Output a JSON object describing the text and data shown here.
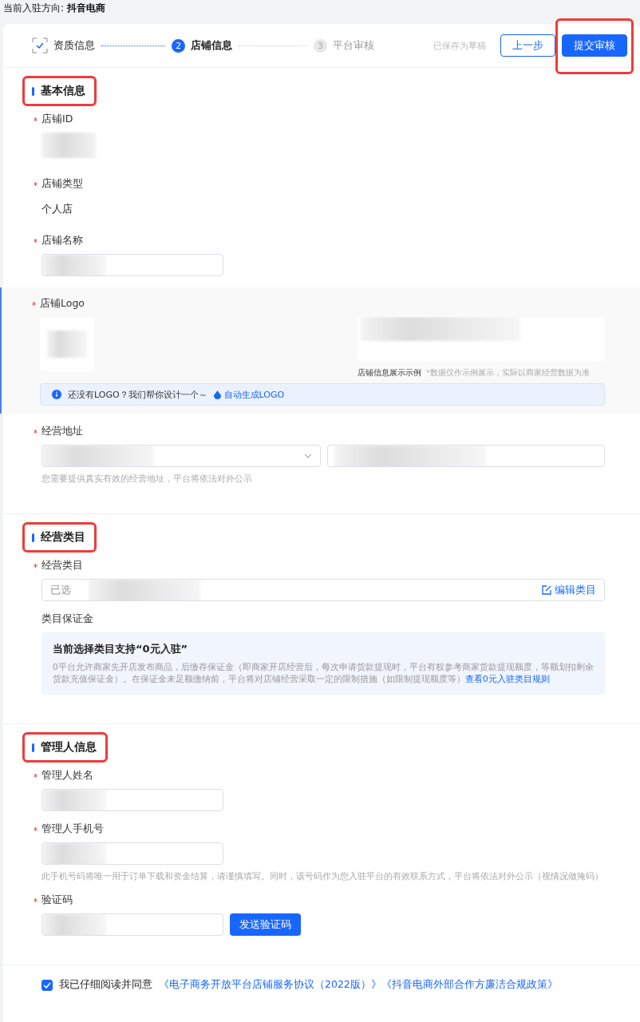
{
  "header": {
    "label": "当前入驻方向:",
    "value": "抖音电商"
  },
  "steps": [
    {
      "label": "资质信息",
      "completed": true,
      "selected": false
    },
    {
      "label": "店铺信息",
      "number": "2",
      "completed": false,
      "selected": true
    },
    {
      "label": "平台审核",
      "number": "3",
      "completed": false,
      "selected": false
    }
  ],
  "draft_status": "已保存为草稿",
  "buttons": [
    {
      "label": "上一步",
      "kind": "outline",
      "highlighted": false
    },
    {
      "label": "提交审核",
      "kind": "primary",
      "highlighted": true
    }
  ],
  "sections": [
    {
      "title": "基本信息",
      "highlighted": true,
      "fields": [
        {
          "kind": "redacted",
          "label": "店铺ID",
          "required": true
        },
        {
          "kind": "text",
          "label": "店铺类型",
          "required": true,
          "value": "个人店"
        },
        {
          "kind": "input",
          "label": "店铺名称",
          "required": true
        },
        {
          "kind": "logo",
          "label": "店铺Logo",
          "required": true,
          "preview_caption": "店铺信息展示示例",
          "preview_note": "*数据仅作示例展示，实际以商家经营数据为准",
          "tip": "还没有LOGO？我们帮你设计一个～",
          "tip_link": "自动生成LOGO"
        },
        {
          "kind": "address",
          "label": "经营地址",
          "required": true,
          "hint": "您需要提供真实有效的经营地址，平台将依法对外公示"
        }
      ]
    },
    {
      "title": "经营类目",
      "highlighted": true,
      "fields": [
        {
          "kind": "category",
          "label": "经营类目",
          "required": true,
          "prefix": "已选",
          "action": "编辑类目"
        },
        {
          "kind": "deposit",
          "label": "类目保证金",
          "required": false,
          "notice_title": "当前选择类目支持“0元入驻”",
          "notice_body": "0平台允许商家先开店发布商品，后缴存保证金（即商家开店经营后，每次申请货款提现时，平台有权参考商家货款提现额度，等额划扣剩余货款充值保证金）。在保证金未足额缴纳前，平台将对店铺经营采取一定的限制措施（如限制提现额度等）",
          "notice_link": "查看0元入驻类目规则"
        }
      ]
    },
    {
      "title": "管理人信息",
      "highlighted": true,
      "fields": [
        {
          "kind": "input",
          "label": "管理人姓名",
          "required": true
        },
        {
          "kind": "input",
          "label": "管理人手机号",
          "required": true,
          "hint": "此手机号码将唯一用于订单下载和资金结算，请谨慎填写。同时，该号码作为您入驻平台的有效联系方式，平台将依法对外公示（视情况做掩码）"
        },
        {
          "kind": "code",
          "label": "验证码",
          "required": true,
          "button": "发送验证码"
        }
      ]
    }
  ],
  "agreement": {
    "checked": true,
    "text": "我已仔细阅读并同意",
    "links": [
      "《电子商务开放平台店铺服务协议（2022版）》",
      "《抖音电商外部合作方廉洁合规政策》"
    ]
  }
}
